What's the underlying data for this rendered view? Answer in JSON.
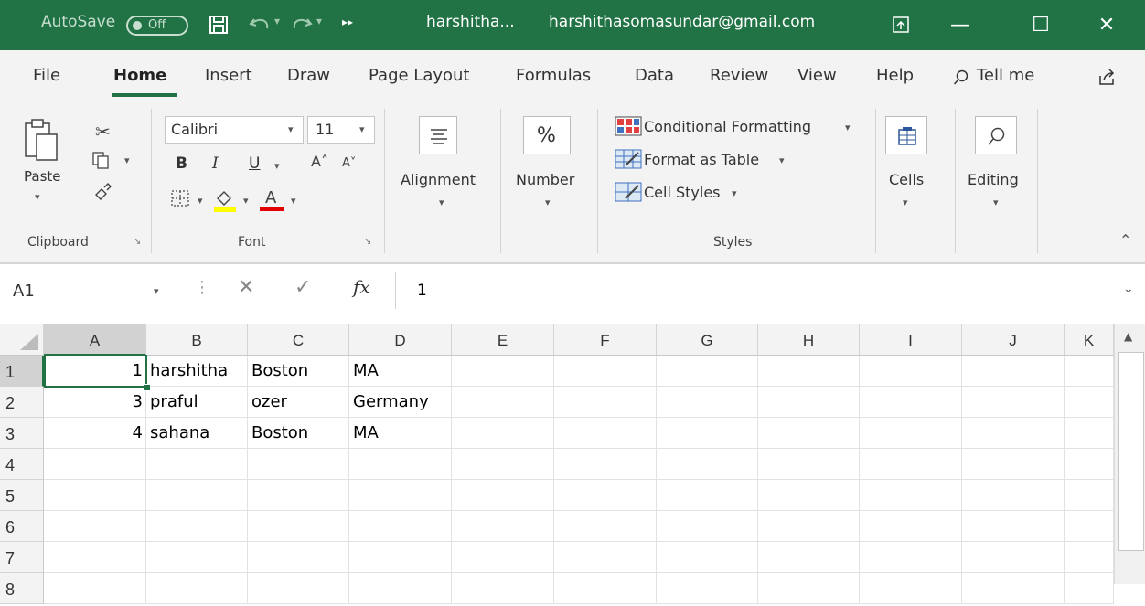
{
  "titlebar": {
    "autosave_label": "AutoSave",
    "autosave_state": "Off",
    "file_name": "harshitha...",
    "account": "harshithasomasundar@gmail.com",
    "minimize": "—",
    "maximize": "☐",
    "close": "✕",
    "overflow": "▸▸"
  },
  "menu": {
    "tabs": [
      "File",
      "Home",
      "Insert",
      "Draw",
      "Page Layout",
      "Formulas",
      "Data",
      "Review",
      "View",
      "Help"
    ],
    "tell_me": "Tell me"
  },
  "ribbon": {
    "clipboard": {
      "paste_label": "Paste",
      "group_label": "Clipboard"
    },
    "font": {
      "font_name": "Calibri",
      "font_size": "11",
      "bold": "B",
      "italic": "I",
      "underline": "U",
      "group_label": "Font"
    },
    "alignment": {
      "label": "Alignment"
    },
    "number": {
      "label": "Number",
      "symbol": "%"
    },
    "styles": {
      "conditional": "Conditional Formatting",
      "format_table": "Format as Table",
      "cell_styles": "Cell Styles",
      "group_label": "Styles"
    },
    "cells": {
      "label": "Cells"
    },
    "editing": {
      "label": "Editing"
    }
  },
  "formula_bar": {
    "name_box": "A1",
    "fx": "fx",
    "value": "1"
  },
  "grid": {
    "columns": [
      "A",
      "B",
      "C",
      "D",
      "E",
      "F",
      "G",
      "H",
      "I",
      "J",
      "K"
    ],
    "row_numbers": [
      "1",
      "2",
      "3",
      "4",
      "5",
      "6",
      "7",
      "8"
    ],
    "rows": [
      [
        "1",
        "harshitha",
        "Boston",
        "MA"
      ],
      [
        "3",
        "praful",
        "ozer",
        "Germany"
      ],
      [
        "4",
        "sahana",
        "Boston",
        "MA"
      ]
    ]
  },
  "colors": {
    "accent": "#217346",
    "ribbon_bg": "#f3f3f3"
  }
}
